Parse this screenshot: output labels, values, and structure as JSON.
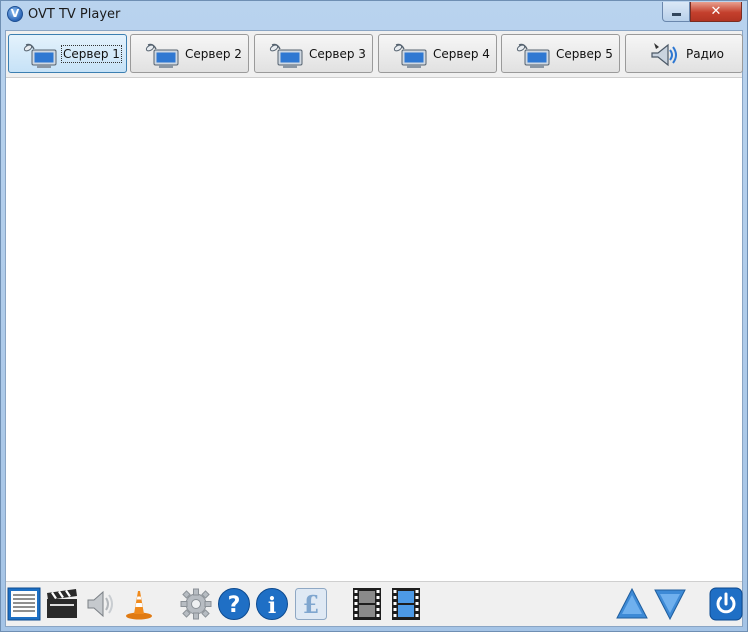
{
  "window": {
    "title": "OVT TV Player",
    "icon_letter": "V",
    "close_glyph": "✕"
  },
  "tabs": [
    {
      "label": "Сервер 1",
      "icon": "satellite-monitor-icon",
      "active": true
    },
    {
      "label": "Сервер 2",
      "icon": "satellite-monitor-icon",
      "active": false
    },
    {
      "label": "Сервер 3",
      "icon": "satellite-monitor-icon",
      "active": false
    },
    {
      "label": "Сервер 4",
      "icon": "satellite-monitor-icon",
      "active": false
    },
    {
      "label": "Сервер 5",
      "icon": "satellite-monitor-icon",
      "active": false
    },
    {
      "label": "Радио",
      "icon": "speaker-music-icon",
      "active": false
    }
  ],
  "toolbar": {
    "icons": [
      "playlist-icon",
      "clapperboard-icon",
      "speaker-icon",
      "vlc-cone-icon",
      "settings-gear-icon",
      "help-icon",
      "info-icon",
      "pound-currency-icon",
      "film-strip-icon",
      "film-strip-blue-icon",
      "arrow-up-icon",
      "arrow-down-icon",
      "power-icon"
    ]
  },
  "colors": {
    "title_bar": "#b9d3ee",
    "active_tab": "#c6e2f7",
    "close_button": "#c4402d",
    "accent_blue": "#1f6fc5"
  }
}
